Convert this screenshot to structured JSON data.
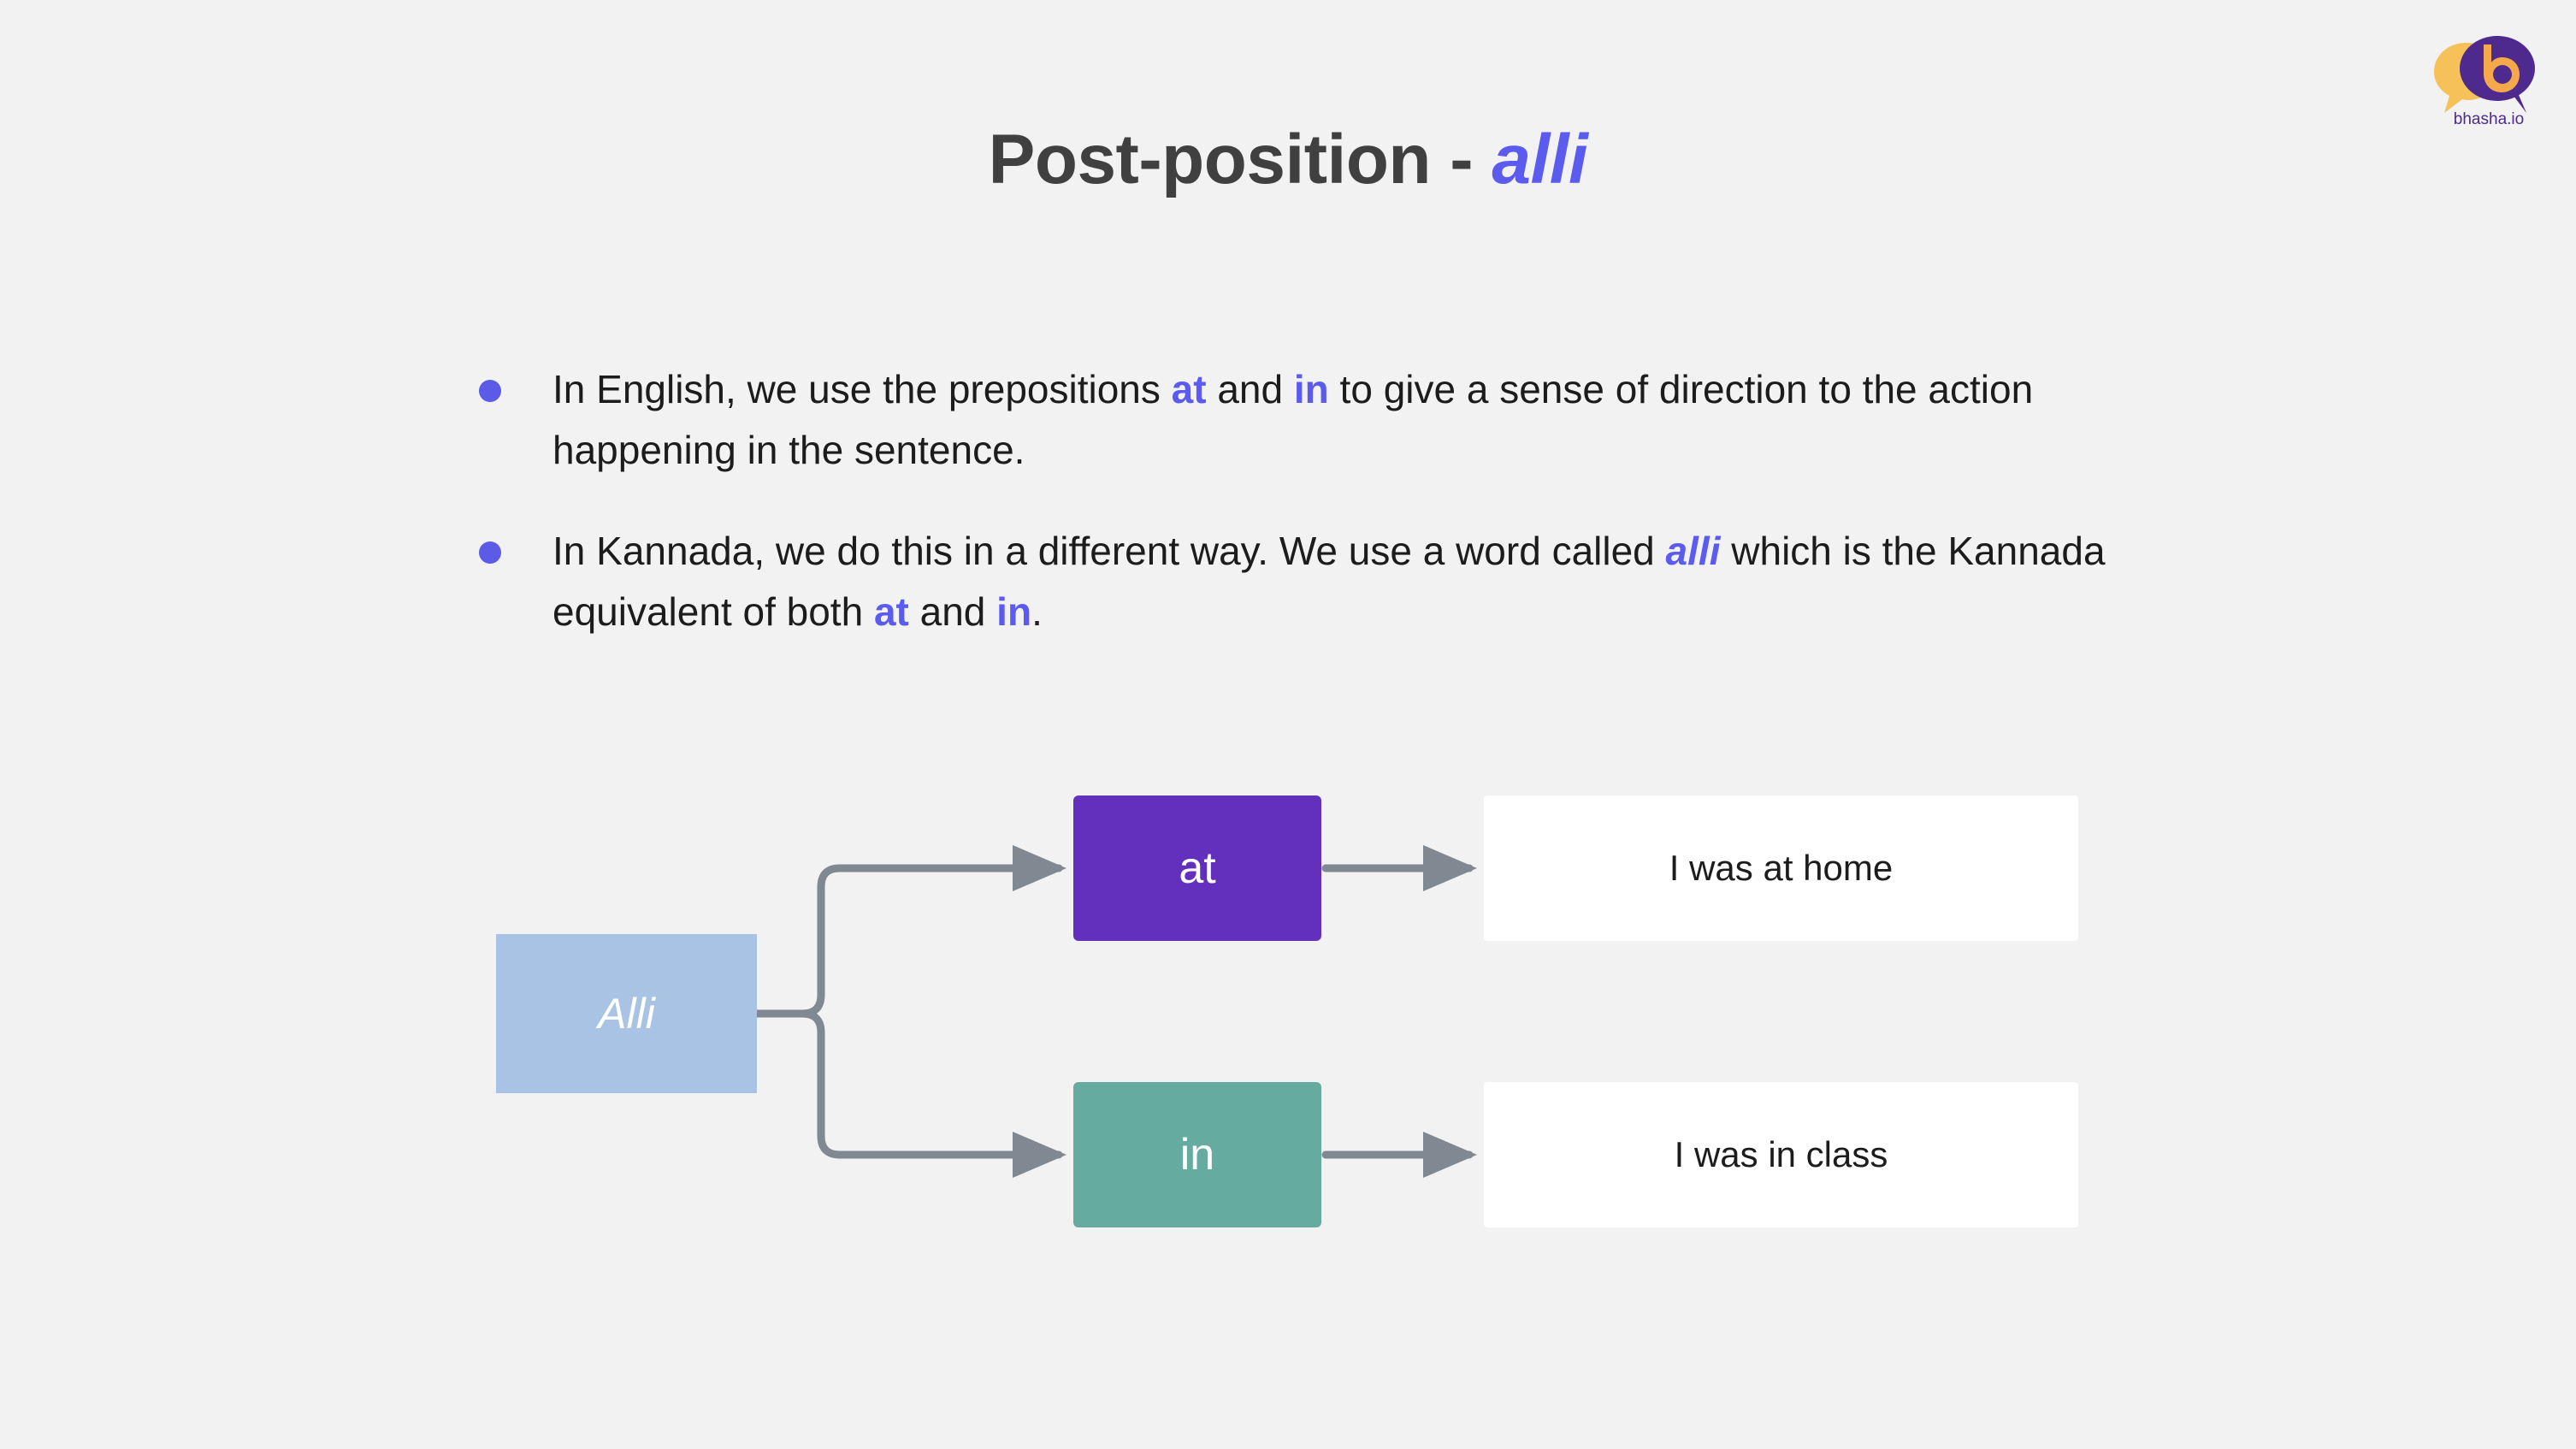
{
  "logo": {
    "name": "bhasha-io-logo",
    "wordmark": "bhasha.io",
    "bubble_back_color": "#f6c159",
    "bubble_front_color": "#4e2a8e",
    "letter_color": "#f6a94a"
  },
  "title": {
    "main": "Post-position - ",
    "accent": "alli"
  },
  "bullets": [
    {
      "parts": [
        {
          "text": "In English, we use the prepositions ",
          "style": "normal"
        },
        {
          "text": "at",
          "style": "accent-bold"
        },
        {
          "text": " and ",
          "style": "normal"
        },
        {
          "text": "in",
          "style": "accent-bold"
        },
        {
          "text": " to give a sense of direction to the action happening in the sentence.",
          "style": "normal"
        }
      ]
    },
    {
      "parts": [
        {
          "text": "In Kannada, we do this in a different way. We use a word called ",
          "style": "normal"
        },
        {
          "text": "alli",
          "style": "accent-bold-italic"
        },
        {
          "text": " which is the Kannada equivalent of both ",
          "style": "normal"
        },
        {
          "text": "at",
          "style": "accent-bold"
        },
        {
          "text": " and ",
          "style": "normal"
        },
        {
          "text": "in",
          "style": "accent-bold"
        },
        {
          "text": ".",
          "style": "normal"
        }
      ]
    }
  ],
  "diagram": {
    "root_label": "Alli",
    "branches": [
      {
        "term": "at",
        "sentence": "I was at home",
        "term_color": "#6230bc"
      },
      {
        "term": "in",
        "sentence": "I was in class",
        "term_color": "#66aba0"
      }
    ],
    "connector_color": "#808891"
  },
  "colors": {
    "background": "#f2f2f2",
    "title": "#404040",
    "accent_blue": "#5b5bf0",
    "bullet_dot": "#5b5be8",
    "root_box": "#a8c3e4",
    "sentence_box": "#ffffff",
    "body_text": "#1c1c1c"
  }
}
